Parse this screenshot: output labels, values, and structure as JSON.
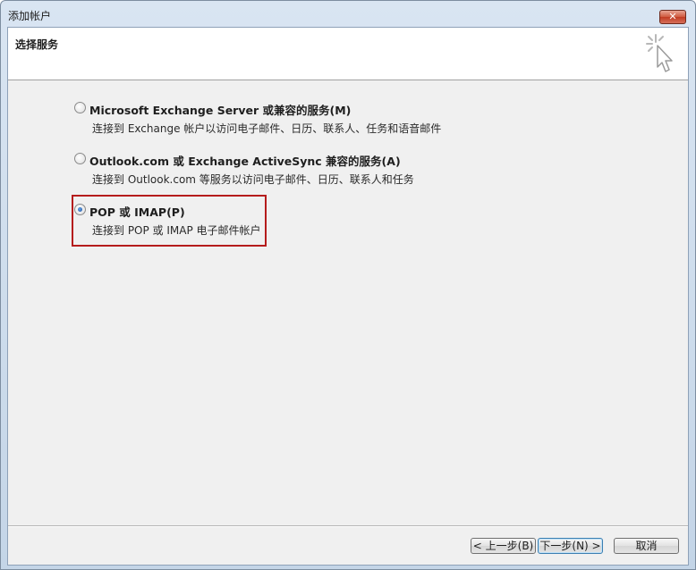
{
  "window": {
    "title": "添加帐户",
    "close_glyph": "✕"
  },
  "header": {
    "title": "选择服务",
    "icon": "sparkle-cursor-icon"
  },
  "options": [
    {
      "label": "Microsoft Exchange Server 或兼容的服务(M)",
      "description": "连接到 Exchange 帐户以访问电子邮件、日历、联系人、任务和语音邮件",
      "checked": false
    },
    {
      "label": "Outlook.com 或 Exchange ActiveSync 兼容的服务(A)",
      "description": "连接到 Outlook.com 等服务以访问电子邮件、日历、联系人和任务",
      "checked": false
    },
    {
      "label": "POP 或 IMAP(P)",
      "description": "连接到 POP 或 IMAP 电子邮件帐户",
      "checked": true
    }
  ],
  "buttons": {
    "back": "< 上一步(B)",
    "next": "下一步(N) >",
    "cancel": "取消"
  },
  "colors": {
    "highlight_border": "#b51c1c",
    "client_bg": "#f0f0f0"
  }
}
